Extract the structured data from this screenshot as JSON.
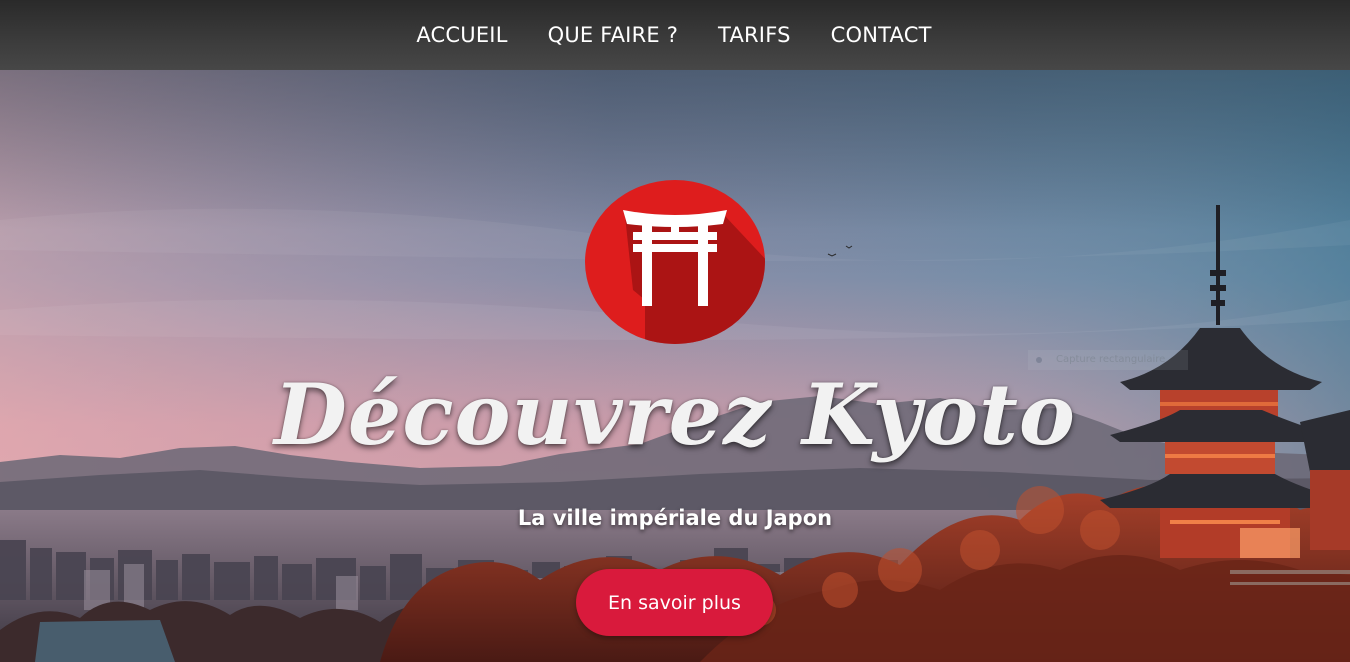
{
  "nav": {
    "items": [
      {
        "label": "ACCUEIL"
      },
      {
        "label": "QUE FAIRE ?"
      },
      {
        "label": "TARIFS"
      },
      {
        "label": "CONTACT"
      }
    ]
  },
  "hero": {
    "logo_icon": "torii-gate-icon",
    "title": "Découvrez Kyoto",
    "subtitle": "La ville impériale du Japon",
    "cta_label": "En savoir plus",
    "background_image": "kyoto-skyline-pagoda-sunset"
  },
  "overlay": {
    "capture_tooltip": "Capture rectangulaire"
  },
  "colors": {
    "nav_bg": "#3c3c3c",
    "cta_bg": "#d91a3c",
    "logo_red": "#dc1c1c",
    "text": "#ffffff"
  }
}
